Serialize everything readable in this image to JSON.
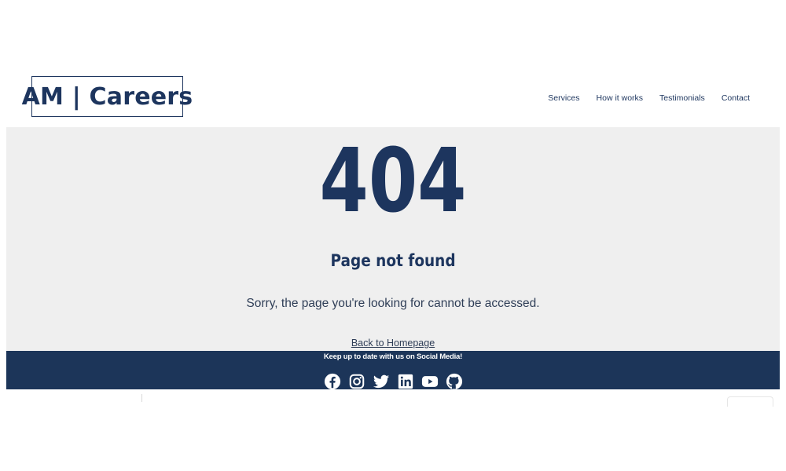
{
  "header": {
    "logo_text": "AM | Careers",
    "nav": [
      "Services",
      "How it works",
      "Testimonials",
      "Contact"
    ]
  },
  "error": {
    "code": "404",
    "title": "Page not found",
    "message": "Sorry, the page you're looking for cannot be accessed.",
    "back_link": "Back to Homepage"
  },
  "footer": {
    "text": "Keep up to date with us on Social Media!",
    "social_icons": [
      "facebook-icon",
      "instagram-icon",
      "twitter-icon",
      "linkedin-icon",
      "youtube-icon",
      "github-icon"
    ]
  },
  "colors": {
    "brand": "#1d355e",
    "footer_bg": "#1c3559",
    "hero_bg": "#efefef"
  }
}
